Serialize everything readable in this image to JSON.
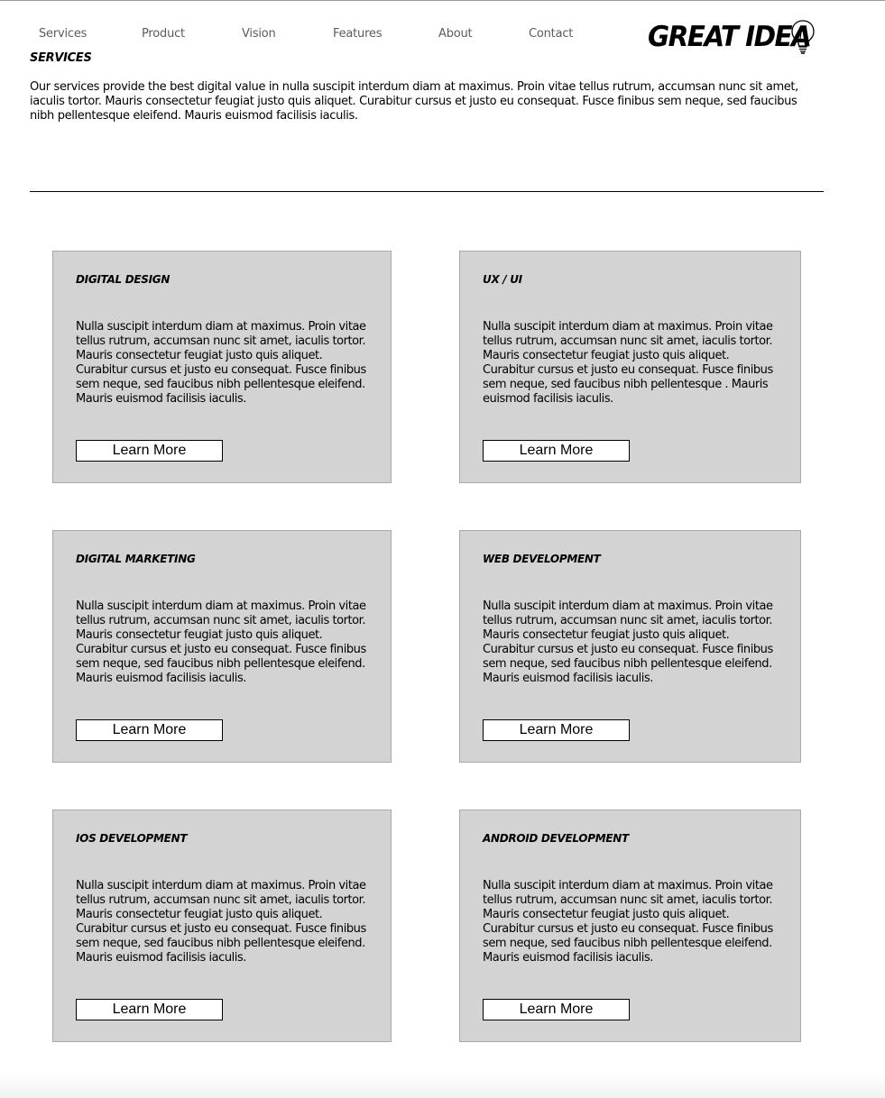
{
  "nav": {
    "items": [
      "Services",
      "Product",
      "Vision",
      "Features",
      "About",
      "Contact"
    ]
  },
  "logo": {
    "text": "GREAT IDEA",
    "icon": "lightbulb-icon"
  },
  "services": {
    "heading": "SERVICES",
    "intro": "Our services provide the best digital value in nulla suscipit interdum diam at maximus. Proin vitae tellus rutrum, accumsan nunc sit amet, iaculis tortor. Mauris consectetur feugiat justo quis aliquet. Curabitur cursus et justo eu consequat. Fusce finibus sem neque, sed faucibus nibh pellentesque eleifend. Mauris euismod facilisis iaculis."
  },
  "cards": [
    {
      "title": "DIGITAL DESIGN",
      "body": "Nulla suscipit interdum diam at maximus. Proin vitae tellus rutrum, accumsan nunc sit amet, iaculis tortor. Mauris consectetur feugiat justo quis aliquet. Curabitur cursus et justo eu consequat. Fusce finibus sem neque, sed faucibus nibh pellentesque eleifend. Mauris euismod facilisis iaculis.",
      "button": "Learn More"
    },
    {
      "title": "UX / UI",
      "body": "Nulla suscipit interdum diam at maximus. Proin vitae tellus rutrum, accumsan nunc sit amet, iaculis tortor. Mauris consectetur feugiat justo quis aliquet. Curabitur cursus et justo eu consequat. Fusce finibus sem neque, sed faucibus nibh pellentesque . Mauris euismod facilisis iaculis.",
      "button": "Learn More"
    },
    {
      "title": "DIGITAL MARKETING",
      "body": "Nulla suscipit interdum diam at maximus. Proin vitae tellus rutrum, accumsan nunc sit amet, iaculis tortor. Mauris consectetur feugiat justo quis aliquet. Curabitur cursus et justo eu consequat. Fusce finibus sem neque, sed faucibus nibh pellentesque eleifend. Mauris euismod facilisis iaculis.",
      "button": "Learn More"
    },
    {
      "title": "WEB DEVELOPMENT",
      "body": "Nulla suscipit interdum diam at maximus. Proin vitae tellus rutrum, accumsan nunc sit amet, iaculis tortor. Mauris consectetur feugiat justo quis aliquet. Curabitur cursus et justo eu consequat. Fusce finibus sem neque, sed faucibus nibh pellentesque eleifend. Mauris euismod facilisis iaculis.",
      "button": "Learn More"
    },
    {
      "title": "IOS DEVELOPMENT",
      "body": "Nulla suscipit interdum diam at maximus. Proin vitae tellus rutrum, accumsan nunc sit amet, iaculis tortor. Mauris consectetur feugiat justo quis aliquet. Curabitur cursus et justo eu consequat. Fusce finibus sem neque, sed faucibus nibh pellentesque eleifend. Mauris euismod facilisis iaculis.",
      "button": "Learn More"
    },
    {
      "title": "ANDROID DEVELOPMENT",
      "body": "Nulla suscipit interdum diam at maximus. Proin vitae tellus rutrum, accumsan nunc sit amet, iaculis tortor. Mauris consectetur feugiat justo quis aliquet. Curabitur cursus et justo eu consequat. Fusce finibus sem neque, sed faucibus nibh pellentesque eleifend. Mauris euismod facilisis iaculis.",
      "button": "Learn More"
    }
  ],
  "colors": {
    "card_background": "#d3d3d3",
    "card_border": "#a9a9a9",
    "nav_text": "#5c5c5c",
    "text": "#000000",
    "button_background": "#ffffff"
  }
}
